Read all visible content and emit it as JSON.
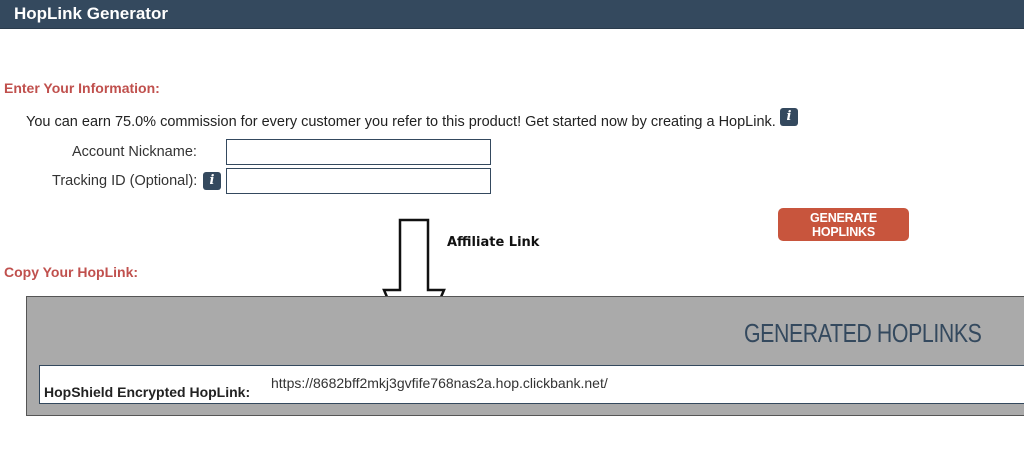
{
  "header": {
    "title": "HopLink Generator",
    "bg_color": "#34495e"
  },
  "info_section": {
    "heading": "Enter Your Information:",
    "intro_text": "You can earn 75.0% commission for every customer you refer to this product! Get started now by creating a HopLink.",
    "info_icon": "info-icon"
  },
  "form": {
    "nickname": {
      "label": "Account Nickname:",
      "value": "",
      "placeholder": ""
    },
    "tracking": {
      "label": "Tracking ID (Optional):",
      "value": "",
      "placeholder": ""
    },
    "generate_button": "Generate HopLinks"
  },
  "annotation": {
    "label": "Affiliate Link",
    "icon": "down-arrow-icon"
  },
  "copy_section": {
    "heading": "Copy Your HopLink:",
    "panel_title": "Generated HopLinks",
    "hoplink_label": "HopShield Encrypted HopLink:",
    "hoplink_value": "https://8682bff2mkj3gvfife768nas2a.hop.clickbank.net/"
  },
  "colors": {
    "accent": "#c0504d",
    "button": "#c8553d",
    "panel": "#aaaaaa",
    "navy": "#34495e"
  }
}
